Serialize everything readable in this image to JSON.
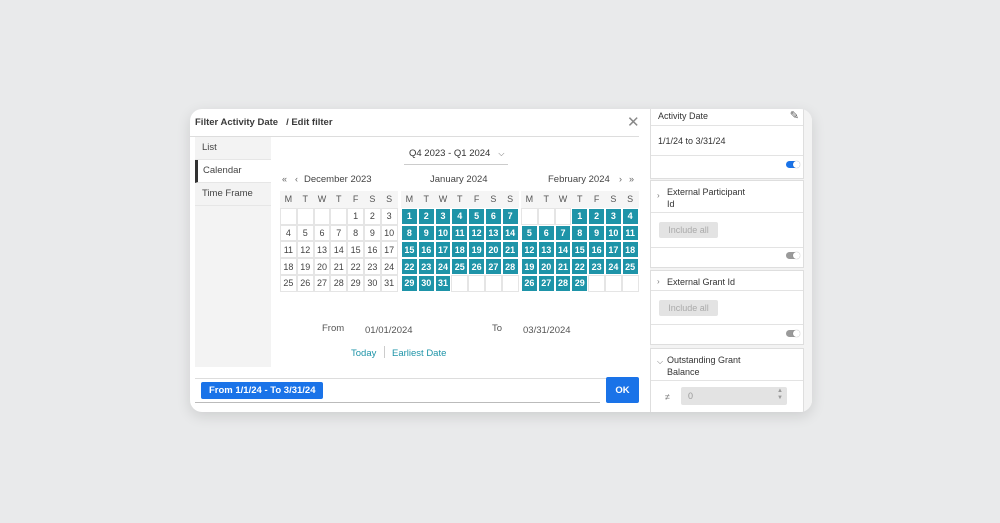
{
  "dialog": {
    "title": "Filter Activity Date",
    "subtitle": "/ Edit filter",
    "close_icon": "close-icon",
    "tabs": [
      "List",
      "Calendar",
      "Time Frame"
    ],
    "active_tab": "Calendar",
    "quarter_label": "Q4 2023 - Q1 2024",
    "nav_prev_year": "«",
    "nav_prev": "‹",
    "nav_next": "›",
    "nav_next_year": "»",
    "months": [
      {
        "name": "December 2023",
        "lead": 4,
        "days": 31,
        "selected_from": null
      },
      {
        "name": "January 2024",
        "lead": 0,
        "days": 31,
        "selected_from": 1
      },
      {
        "name": "February 2024",
        "lead": 3,
        "days": 29,
        "selected_from": 1
      }
    ],
    "weekdays": [
      "M",
      "T",
      "W",
      "T",
      "F",
      "S",
      "S"
    ],
    "from_label": "From",
    "from_value": "01/01/2024",
    "to_label": "To",
    "to_value": "03/31/2024",
    "today_link": "Today",
    "earliest_link": "Earliest Date",
    "chip": "From 1/1/24 - To 3/31/24",
    "ok_label": "OK"
  },
  "panel": {
    "activity_date": {
      "title": "Activity Date",
      "value": "1/1/24 to 3/31/24",
      "toggle_on": true
    },
    "external_participant": {
      "title_line1": "External Participant",
      "title_line2": "Id",
      "include_label": "Include all",
      "toggle_on": false
    },
    "external_grant": {
      "title": "External Grant Id",
      "include_label": "Include all",
      "toggle_on": false
    },
    "outstanding": {
      "title_line1": "Outstanding Grant",
      "title_line2": "Balance",
      "operator": "≠",
      "value": "0"
    }
  },
  "colors": {
    "selected": "#1e94a8",
    "primary": "#1a73e8"
  }
}
